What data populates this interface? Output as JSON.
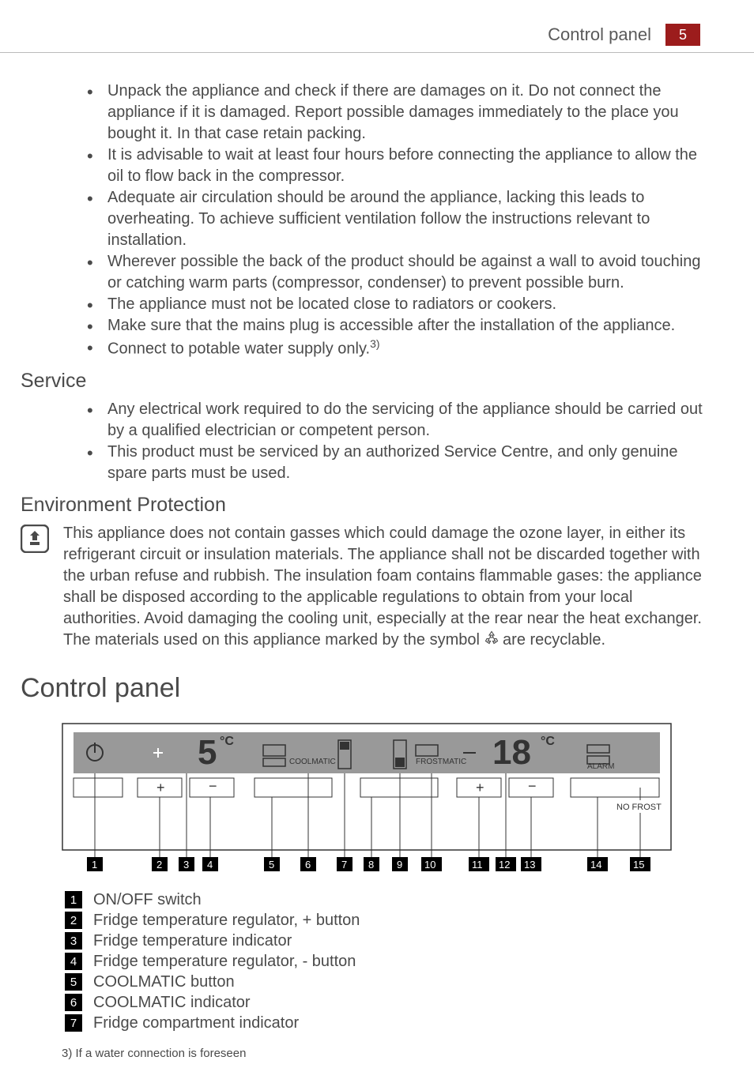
{
  "header": {
    "title": "Control panel",
    "page": "5"
  },
  "safety_bullets": [
    "Unpack the appliance and check if there are damages on it. Do not connect the appliance if it is damaged. Report possible damages immediately to the place you bought it. In that case retain packing.",
    "It is advisable to wait at least four hours before connecting the appliance to allow the oil to flow back in the compressor.",
    "Adequate air circulation should be around the appliance, lacking this leads to overheating. To achieve sufficient ventilation follow the instructions relevant to installation.",
    "Wherever possible the back of the product should be against a wall to avoid touching or catching warm parts (compressor, condenser) to prevent possible burn.",
    "The appliance must not be located close to radiators or cookers.",
    "Make sure that the mains plug is accessible after the installation of the appliance.",
    "Connect to potable water supply only."
  ],
  "safety_footnote_ref": "3)",
  "service": {
    "heading": "Service",
    "bullets": [
      "Any electrical work required to do the servicing of the appliance should be carried out by a qualified electrician or competent person.",
      "This product must be serviced by an authorized Service Centre, and only genuine spare parts must be used."
    ]
  },
  "environment": {
    "heading": "Environment Protection",
    "text_before": "This appliance does not contain gasses which could damage the ozone layer, in either its refrigerant circuit or insulation materials. The appliance shall not be discarded together with the urban refuse and rubbish. The insulation foam contains flammable gases: the appliance shall be disposed according to the applicable regulations to obtain from your local authorities. Avoid damaging the cooling unit, especially at the rear near the heat exchanger. The materials used on this appliance marked by the symbol ",
    "text_after": " are recyclable."
  },
  "control_panel": {
    "heading": "Control panel",
    "display": {
      "fridge_temp": "5",
      "fridge_unit": "°C",
      "coolmatic": "COOLMATIC",
      "frostmatic": "FROSTMATIC",
      "freezer_temp": "18",
      "freezer_unit": "°C",
      "alarm": "ALARM",
      "nofrost": "NO FROST"
    },
    "callouts": [
      "1",
      "2",
      "3",
      "4",
      "5",
      "6",
      "7",
      "8",
      "9",
      "10",
      "11",
      "12",
      "13",
      "14",
      "15"
    ],
    "legend": [
      {
        "num": "1",
        "label": "ON/OFF switch"
      },
      {
        "num": "2",
        "label": "Fridge temperature regulator, + button"
      },
      {
        "num": "3",
        "label": "Fridge temperature indicator"
      },
      {
        "num": "4",
        "label": "Fridge temperature regulator, - button"
      },
      {
        "num": "5",
        "label": "COOLMATIC button"
      },
      {
        "num": "6",
        "label": "COOLMATIC indicator"
      },
      {
        "num": "7",
        "label": "Fridge compartment indicator"
      }
    ]
  },
  "footnote": "3) If a water connection is foreseen"
}
